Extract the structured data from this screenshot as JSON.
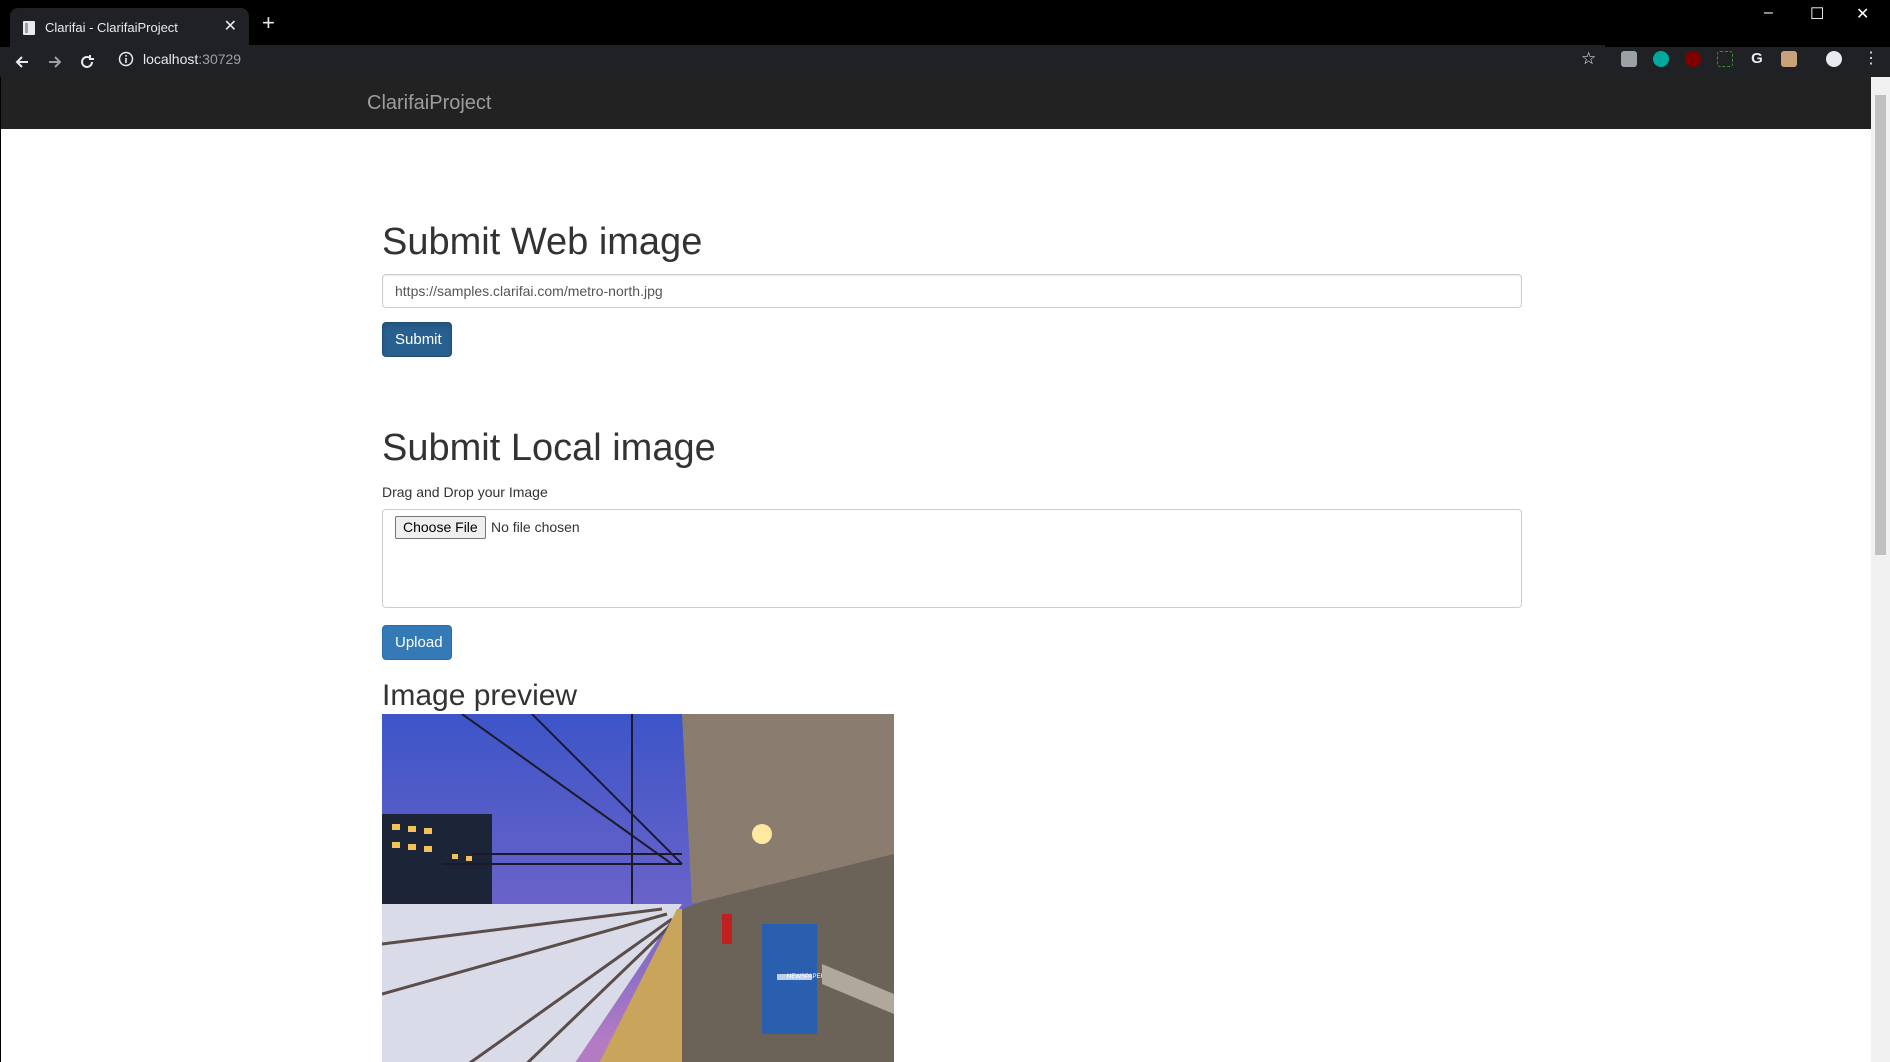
{
  "browser": {
    "tab_title": "Clarifai - ClarifaiProject",
    "url_host": "localhost",
    "url_port": ":30729"
  },
  "navbar": {
    "brand": "ClarifaiProject"
  },
  "web_section": {
    "heading": "Submit Web image",
    "url_value": "https://samples.clarifai.com/metro-north.jpg",
    "submit_label": "Submit"
  },
  "local_section": {
    "heading": "Submit Local image",
    "helper": "Drag and Drop your Image",
    "choose_label": "Choose File",
    "no_file": "No file chosen",
    "upload_label": "Upload"
  },
  "preview": {
    "heading": "Image preview",
    "sign_text": "NEWSPAPERS"
  },
  "colors": {
    "navbar": "#222222",
    "primary": "#337ab7",
    "chrome": "#202124"
  }
}
